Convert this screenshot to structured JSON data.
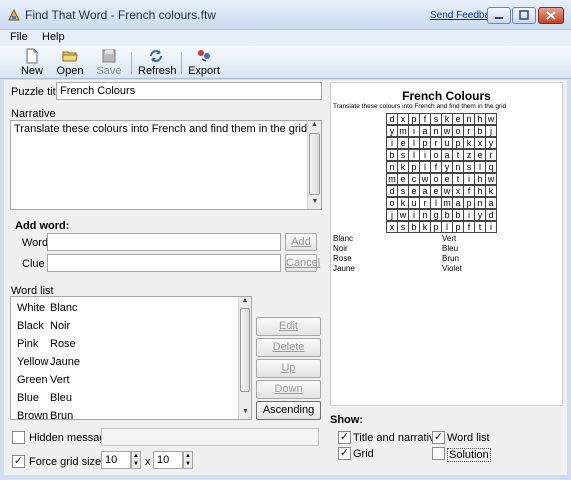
{
  "window": {
    "title": "Find That Word - French colours.ftw",
    "feedback": "Send Feedback"
  },
  "menu": [
    "File",
    "Help"
  ],
  "toolbar": {
    "new": "New",
    "open": "Open",
    "save": "Save",
    "refresh": "Refresh",
    "export": "Export"
  },
  "form": {
    "puzzle_title_label": "Puzzle title",
    "puzzle_title_value": "French Colours",
    "narrative_label": "Narrative",
    "narrative_value": "Translate these colours into French and find them in the grid",
    "add_word_heading": "Add word:",
    "word_label": "Word",
    "clue_label": "Clue",
    "add_button": "Add",
    "cancel_button": "Cancel",
    "word_list_label": "Word list",
    "edit_button": "Edit",
    "delete_button": "Delete",
    "up_button": "Up",
    "down_button": "Down",
    "ascending_button": "Ascending",
    "hidden_message_label": "Hidden message",
    "force_grid_label": "Force grid size to",
    "grid_w": "10",
    "grid_x": "x",
    "grid_h": "10"
  },
  "word_list": [
    [
      "White",
      "Blanc"
    ],
    [
      "Black",
      "Noir"
    ],
    [
      "Pink",
      "Rose"
    ],
    [
      "Yellow",
      "Jaune"
    ],
    [
      "Green",
      "Vert"
    ],
    [
      "Blue",
      "Bleu"
    ],
    [
      "Brown",
      "Brun"
    ]
  ],
  "preview": {
    "title": "French Colours",
    "narrative": "Translate these colours into French and find them in the grid",
    "grid": [
      [
        "d",
        "x",
        "p",
        "f",
        "s",
        "k",
        "e",
        "n",
        "h",
        "w"
      ],
      [
        "y",
        "m",
        "i",
        "a",
        "n",
        "w",
        "o",
        "r",
        "b",
        "j"
      ],
      [
        "i",
        "e",
        "l",
        "p",
        "r",
        "u",
        "p",
        "k",
        "x",
        "y"
      ],
      [
        "b",
        "s",
        "l",
        "i",
        "o",
        "a",
        "t",
        "z",
        "e",
        "r"
      ],
      [
        "n",
        "k",
        "p",
        "l",
        "f",
        "y",
        "n",
        "s",
        "l",
        "q"
      ],
      [
        "m",
        "e",
        "c",
        "w",
        "o",
        "e",
        "t",
        "i",
        "h",
        "w"
      ],
      [
        "d",
        "s",
        "e",
        "a",
        "e",
        "w",
        "x",
        "f",
        "h",
        "k"
      ],
      [
        "o",
        "k",
        "u",
        "r",
        "l",
        "m",
        "a",
        "p",
        "n",
        "a"
      ],
      [
        "j",
        "w",
        "i",
        "n",
        "g",
        "b",
        "b",
        "i",
        "y",
        "d"
      ],
      [
        "x",
        "s",
        "b",
        "k",
        "p",
        "l",
        "p",
        "f",
        "t",
        "i"
      ]
    ],
    "words_left": [
      "Blanc",
      "Noir",
      "Rose",
      "Jaune"
    ],
    "words_right": [
      "Vert",
      "Bleu",
      "Brun",
      "Violet"
    ]
  },
  "show": {
    "heading": "Show:",
    "title_and_narrative": "Title and narrative",
    "word_list": "Word list",
    "grid": "Grid",
    "solution": "Solution",
    "checked": {
      "title_and_narrative": true,
      "word_list": true,
      "grid": true,
      "solution": false,
      "hidden_message": false,
      "force_grid": true
    }
  }
}
